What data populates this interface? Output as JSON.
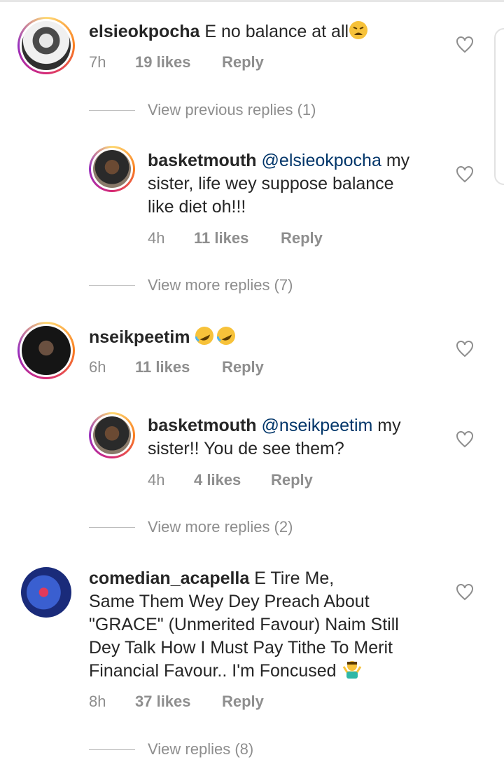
{
  "comments": [
    {
      "username": "elsieokpocha",
      "text": "E no balance at all",
      "emoji": "weary-face",
      "time": "7h",
      "likes": "19 likes",
      "reply": "Reply"
    },
    {
      "username": "basketmouth",
      "mention": "@elsieokpocha",
      "text_line1": "my",
      "text_line2": "sister, life wey suppose balance",
      "text_line3": "like diet oh!!!",
      "time": "4h",
      "likes": "11 likes",
      "reply": "Reply"
    },
    {
      "username": "nseikpeetim",
      "emoji": "rolling-on-floor-laughing x2",
      "time": "6h",
      "likes": "11 likes",
      "reply": "Reply"
    },
    {
      "username": "basketmouth",
      "mention": "@nseikpeetim",
      "text_line1": "my",
      "text_line2": "sister!! You de see them?",
      "time": "4h",
      "likes": "4 likes",
      "reply": "Reply"
    },
    {
      "username": "comedian_acapella",
      "text_line1": "E Tire Me,",
      "text_line2": "Same Them Wey Dey Preach About",
      "text_line3": "\"GRACE\" (Unmerited Favour) Naim Still",
      "text_line4": "Dey Talk How I Must Pay Tithe To Merit",
      "text_line5": "Financial Favour.. I'm Foncused",
      "emoji": "person-shrugging",
      "time": "8h",
      "likes": "37 likes",
      "reply": "Reply"
    }
  ],
  "view_links": {
    "previous": "View previous replies (1)",
    "more1": "View more replies (7)",
    "more2": "View more replies (2)",
    "replies": "View replies (8)"
  },
  "colors": {
    "text": "#262626",
    "meta": "#8e8e8e",
    "mention": "#003569"
  }
}
